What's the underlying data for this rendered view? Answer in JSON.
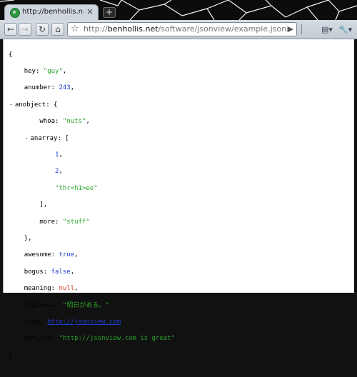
{
  "tab": {
    "title": "http://benhollis.net/soft...",
    "close": "×"
  },
  "new_tab": "+",
  "toolbar": {
    "back": "←",
    "forward": "→",
    "reload": "↻",
    "home": "⌂",
    "star": "☆",
    "url_prefix": "http://",
    "url_host": "benhollis.net",
    "url_path": "/software/jsonview/example.json",
    "go": "▶",
    "page_menu": "▤▾",
    "tools_menu": "🔧▾"
  },
  "json": {
    "open": "{",
    "hey_key": "hey",
    "hey_val": "\"guy\"",
    "anumber_key": "anumber",
    "anumber_val": "243",
    "anobject_key": "anobject",
    "anobject_open": "{",
    "whoa_key": "whoa",
    "whoa_val": "\"nuts\"",
    "anarray_key": "anarray",
    "anarray_open": "[",
    "arr0": "1",
    "arr1": "2",
    "arr2": "\"thr<h1>ee\"",
    "anarray_close": "],",
    "more_key": "more",
    "more_val": "\"stuff\"",
    "anobject_close": "},",
    "awesome_key": "awesome",
    "awesome_val": "true",
    "bogus_key": "bogus",
    "bogus_val": "false",
    "meaning_key": "meaning",
    "meaning_val": "null",
    "japanese_key": "japanese",
    "japanese_val": "\"明日がある。\"",
    "link_key": "link",
    "link_val": "http://jsonview.com",
    "notlink_key": "notLink",
    "notlink_val": "\"http://jsonview.com is great\"",
    "close": "}",
    "collapser": "-"
  },
  "colors": {
    "string": "#2aa52a",
    "number": "#1b3fd1",
    "null": "#d8331b",
    "frame": "#0c0c0c"
  }
}
